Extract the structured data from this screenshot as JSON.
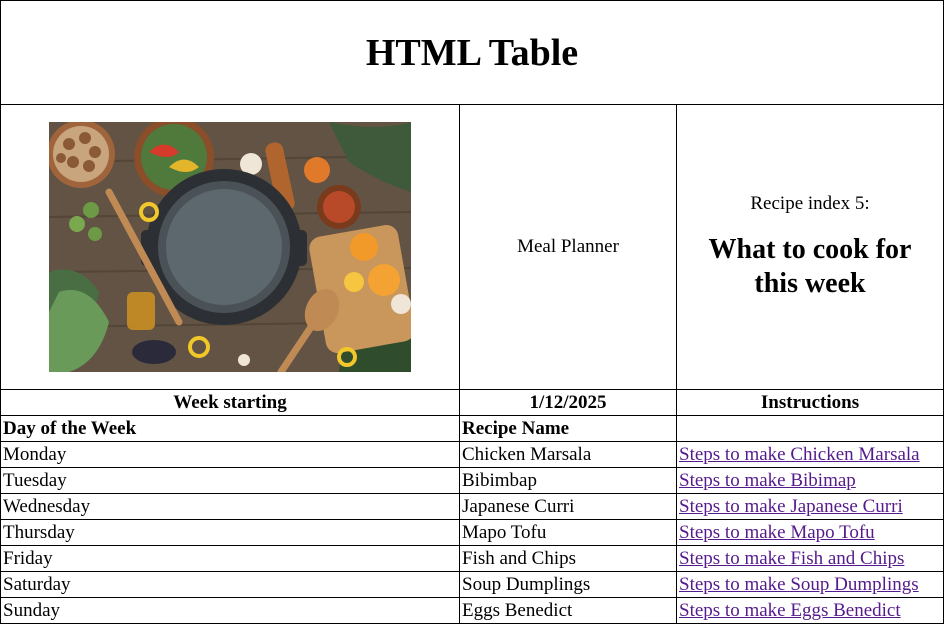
{
  "page": {
    "title": "HTML Table"
  },
  "hero": {
    "planner_label": "Meal Planner",
    "recipe_index_label": "Recipe index 5:",
    "headline_line1": "What to cook for",
    "headline_line2": "this week"
  },
  "week": {
    "label": "Week starting",
    "date": "1/12/2025",
    "instructions_label": "Instructions"
  },
  "columns": {
    "day": "Day of the Week",
    "recipe": "Recipe Name"
  },
  "schedule": [
    {
      "day": "Monday",
      "recipe": "Chicken Marsala",
      "link": "Steps to make Chicken Marsala"
    },
    {
      "day": "Tuesday",
      "recipe": "Bibimbap",
      "link": "Steps to make Bibimap"
    },
    {
      "day": "Wednesday",
      "recipe": "Japanese Curri",
      "link": "Steps to make Japanese Curri"
    },
    {
      "day": "Thursday",
      "recipe": "Mapo Tofu",
      "link": "Steps to make Mapo Tofu"
    },
    {
      "day": "Friday",
      "recipe": "Fish and Chips",
      "link": "Steps to make Fish and Chips"
    },
    {
      "day": "Saturday",
      "recipe": "Soup Dumplings",
      "link": "Steps to make Soup Dumplings"
    },
    {
      "day": "Sunday",
      "recipe": "Eggs Benedict",
      "link": "Steps to make Eggs Benedict"
    }
  ],
  "colors": {
    "link_visited": "#551a8b",
    "border": "#000000"
  }
}
